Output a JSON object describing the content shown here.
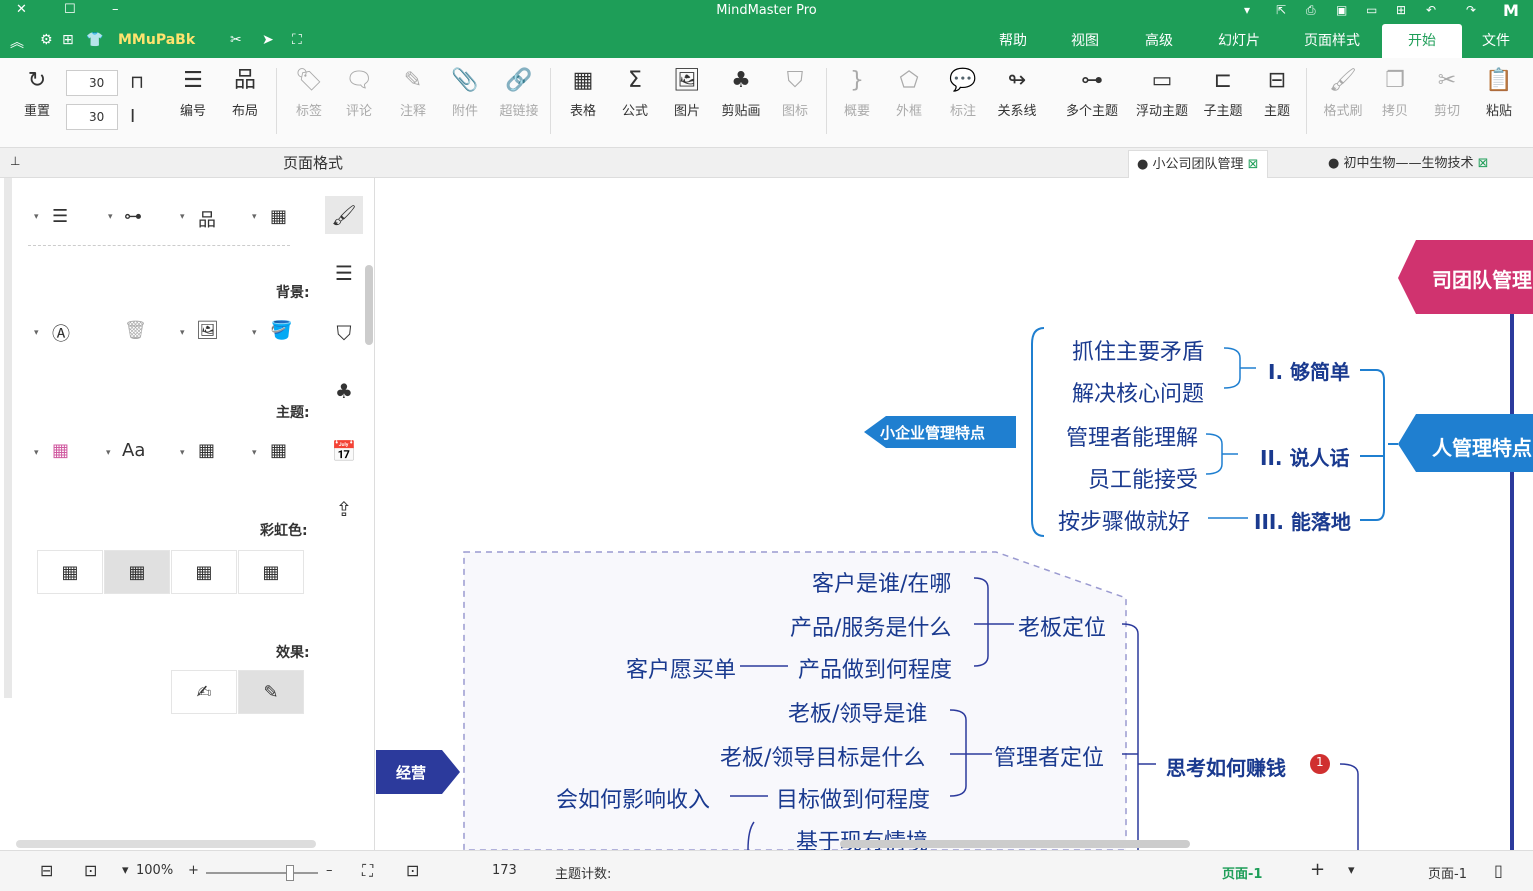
{
  "app": {
    "title": "MindMaster Pro",
    "brand": "MMuPaBk",
    "colors": {
      "accent": "#1e9e58",
      "pink": "#d0336f",
      "blue": "#1f7fd0",
      "navy": "#2c3a9c"
    }
  },
  "menu_tabs": [
    "文件",
    "开始",
    "页面样式",
    "幻灯片",
    "高级",
    "视图",
    "帮助"
  ],
  "ribbon": {
    "paste": "粘贴",
    "cut": "剪切",
    "copy": "拷贝",
    "format_painter": "格式刷",
    "topic": "主题",
    "subtopic": "子主题",
    "floating_topic": "浮动主题",
    "multi_topic": "多个主题",
    "relationship": "关系线",
    "callout": "标注",
    "boundary": "外框",
    "summary": "概要",
    "icon": "图标",
    "clipart": "剪贴画",
    "image": "图片",
    "formula": "公式",
    "table": "表格",
    "hyperlink": "超链接",
    "attachment": "附件",
    "note": "注释",
    "comment": "评论",
    "tag": "标签",
    "layout": "布局",
    "numbering": "编号",
    "reset": "重置",
    "spin1": "30",
    "spin2": "30"
  },
  "doc_tabs": [
    "初中生物——生物技术",
    "小公司团队管理"
  ],
  "panel": {
    "title": "页面格式",
    "background": "背景:",
    "theme": "主题:",
    "rainbow": "彩虹色:",
    "effect": "效果:",
    "font_icon": "Aa"
  },
  "mindmap": {
    "root_partial": "司团队管理",
    "branch_blue": "人管理特点",
    "small_biz": "小企业管理特点",
    "l1": "I. 够简单",
    "l1a": "抓住主要矛盾",
    "l1b": "解决核心问题",
    "l2": "II. 说人话",
    "l2a": "管理者能理解",
    "l2b": "员工能接受",
    "l3": "III. 能落地",
    "l3a": "按步骤做就好",
    "think": "思考如何赚钱",
    "think_badge": "1",
    "boss_pos": "老板定位",
    "c1": "客户是谁/在哪",
    "c2": "产品/服务是什么",
    "c3": "产品做到何程度",
    "c3a": "客户愿买单",
    "mgr_pos": "管理者定位",
    "m1": "老板/领导是谁",
    "m2": "老板/领导目标是什么",
    "m3": "目标做到何程度",
    "m3a": "会如何影响收入",
    "m4": "基于现有情境",
    "operate": "经营"
  },
  "status": {
    "page_left": "页面-1",
    "page_tab": "页面-1",
    "topic_count_label": "主题计数:",
    "topic_count": "173",
    "zoom": "100%"
  }
}
